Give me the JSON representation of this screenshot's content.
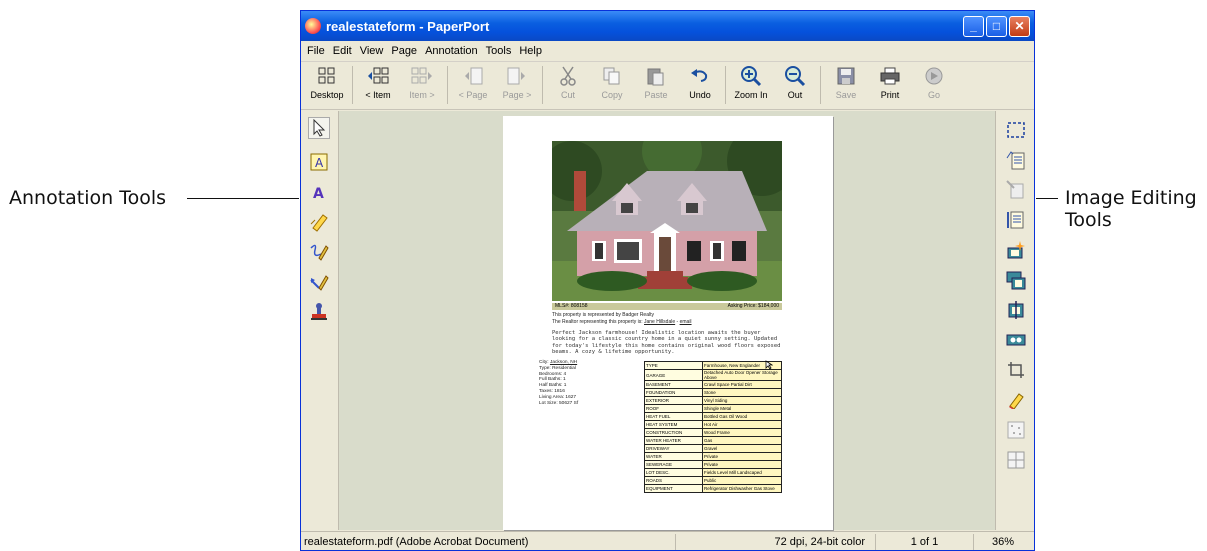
{
  "callouts": {
    "left": "Annotation Tools",
    "right_line1": "Image Editing",
    "right_line2": "Tools"
  },
  "window": {
    "title": "realestateform - PaperPort",
    "minimize": "_",
    "maximize": "□",
    "close": "✕"
  },
  "menu": [
    "File",
    "Edit",
    "View",
    "Page",
    "Annotation",
    "Tools",
    "Help"
  ],
  "toolbar": [
    {
      "label": "Desktop",
      "icon": "desktop-icon",
      "enabled": true
    },
    {
      "label": "< Item",
      "icon": "prev-item-icon",
      "enabled": true
    },
    {
      "label": "Item >",
      "icon": "next-item-icon",
      "enabled": false
    },
    {
      "label": "< Page",
      "icon": "prev-page-icon",
      "enabled": false
    },
    {
      "label": "Page >",
      "icon": "next-page-icon",
      "enabled": false
    },
    {
      "label": "Cut",
      "icon": "scissors-icon",
      "enabled": false
    },
    {
      "label": "Copy",
      "icon": "copy-icon",
      "enabled": false
    },
    {
      "label": "Paste",
      "icon": "paste-icon",
      "enabled": false
    },
    {
      "label": "Undo",
      "icon": "undo-icon",
      "enabled": true
    },
    {
      "label": "Zoom In",
      "icon": "zoom-in-icon",
      "enabled": true
    },
    {
      "label": "Out",
      "icon": "zoom-out-icon",
      "enabled": true
    },
    {
      "label": "Save",
      "icon": "save-icon",
      "enabled": false
    },
    {
      "label": "Print",
      "icon": "printer-icon",
      "enabled": true
    },
    {
      "label": "Go",
      "icon": "go-icon",
      "enabled": false
    }
  ],
  "annotation_tools": [
    "select-arrow-icon",
    "text-box-note-icon",
    "text-tool-icon",
    "highlighter-icon",
    "freehand-pen-icon",
    "arrow-pen-icon",
    "stamp-icon"
  ],
  "image_tools": [
    "marquee-select-icon",
    "page-properties-icon",
    "enhance-icon",
    "page-edit-icon",
    "sparkle-icon",
    "photo-icon",
    "straighten-icon",
    "red-eye-icon",
    "crop-icon",
    "eraser-icon",
    "dots-icon",
    "grid-icon"
  ],
  "document": {
    "mls_label": "MLS#: 808158",
    "price_label": "Asking Price: $184,000",
    "represented": "This property is represented by Badger Realty",
    "realtor": "The Realtor representing this property is:",
    "realtor_link": "Jane Hillsdale",
    "realtor_sep": " - ",
    "realtor_email": "email",
    "description": "Perfect Jackson farmhouse! Idealistic location awaits the buyer looking for a classic country home in a quiet sunny setting. Updated for today's lifestyle this home contains original wood floors exposed beams. A cozy & lifetime opportunity.",
    "facts_city_label": "City: ",
    "facts_city": "Jackson, NH",
    "facts": [
      "Type: Residential",
      "Bedrooms: 4",
      "Full Baths: 1",
      "Half Baths: 1",
      "Taxes: 1816",
      "Living Area: 1627",
      "Lot Size: 50627 Sf"
    ],
    "specs": [
      [
        "TYPE",
        "Farmhouse, New Englander"
      ],
      [
        "GARAGE",
        "Detached Auto Door Opener Storage Above"
      ],
      [
        "BASEMENT",
        "Crawl Space Partial Dirt"
      ],
      [
        "FOUNDATION",
        "Stone"
      ],
      [
        "EXTERIOR",
        "Vinyl Siding"
      ],
      [
        "ROOF",
        "Shingle Metal"
      ],
      [
        "HEAT FUEL",
        "Bottled Gas Oil Wood"
      ],
      [
        "HEAT SYSTEM",
        "Hot Air"
      ],
      [
        "CONSTRUCTION",
        "Wood Frame"
      ],
      [
        "WATER HEATER",
        "Gas"
      ],
      [
        "DRIVEWAY",
        "Gravel"
      ],
      [
        "WATER",
        "Private"
      ],
      [
        "SEWERAGE",
        "Private"
      ],
      [
        "LOT DESC.",
        "Fields Level Mill Landscaped"
      ],
      [
        "ROADS",
        "Public"
      ],
      [
        "EQUIPMENT",
        "Refrigerator Dishwasher Gas Stove"
      ]
    ]
  },
  "status": {
    "file": "realestateform.pdf (Adobe Acrobat Document)",
    "resolution": "72 dpi, 24-bit color",
    "pages": "1 of 1",
    "zoom": "36%"
  }
}
